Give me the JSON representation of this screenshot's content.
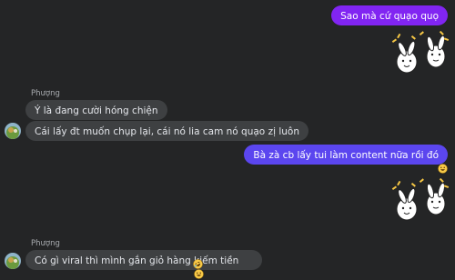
{
  "thread": {
    "messages": [
      {
        "id": "m1",
        "direction": "outgoing",
        "text": "Sao mà cứ quạo quọ"
      },
      {
        "id": "m2",
        "direction": "outgoing",
        "type": "sticker",
        "sticker": "dancing-bunny-sticker"
      },
      {
        "id": "m3",
        "direction": "incoming",
        "sender": "Phượng",
        "text": "Ý là đang cười hóng chiện"
      },
      {
        "id": "m4",
        "direction": "incoming",
        "text": "Cái lấy đt muốn chụp lại, cái nó lia cam nó quạo zị luôn"
      },
      {
        "id": "m5",
        "direction": "outgoing",
        "text": "Bà zà cb lấy tui làm content nữa rồi đó",
        "reaction": "grinning-face"
      },
      {
        "id": "m6",
        "direction": "outgoing",
        "type": "sticker",
        "sticker": "dancing-bunny-sticker"
      },
      {
        "id": "m7",
        "direction": "incoming",
        "sender": "Phượng",
        "text": "Có gì viral thì mình gắn giỏ hàng kiếm tiền",
        "inline_emoji": "rolling-laughing-face",
        "reaction": "grinning-face"
      }
    ]
  },
  "colors": {
    "background": "#242526",
    "outgoing_bubble": "#8125f2",
    "outgoing_bubble_blue": "#5b46ef",
    "incoming_bubble": "#3e4042",
    "incoming_text": "#e4e6eb",
    "sender_name": "#a8abaf"
  }
}
